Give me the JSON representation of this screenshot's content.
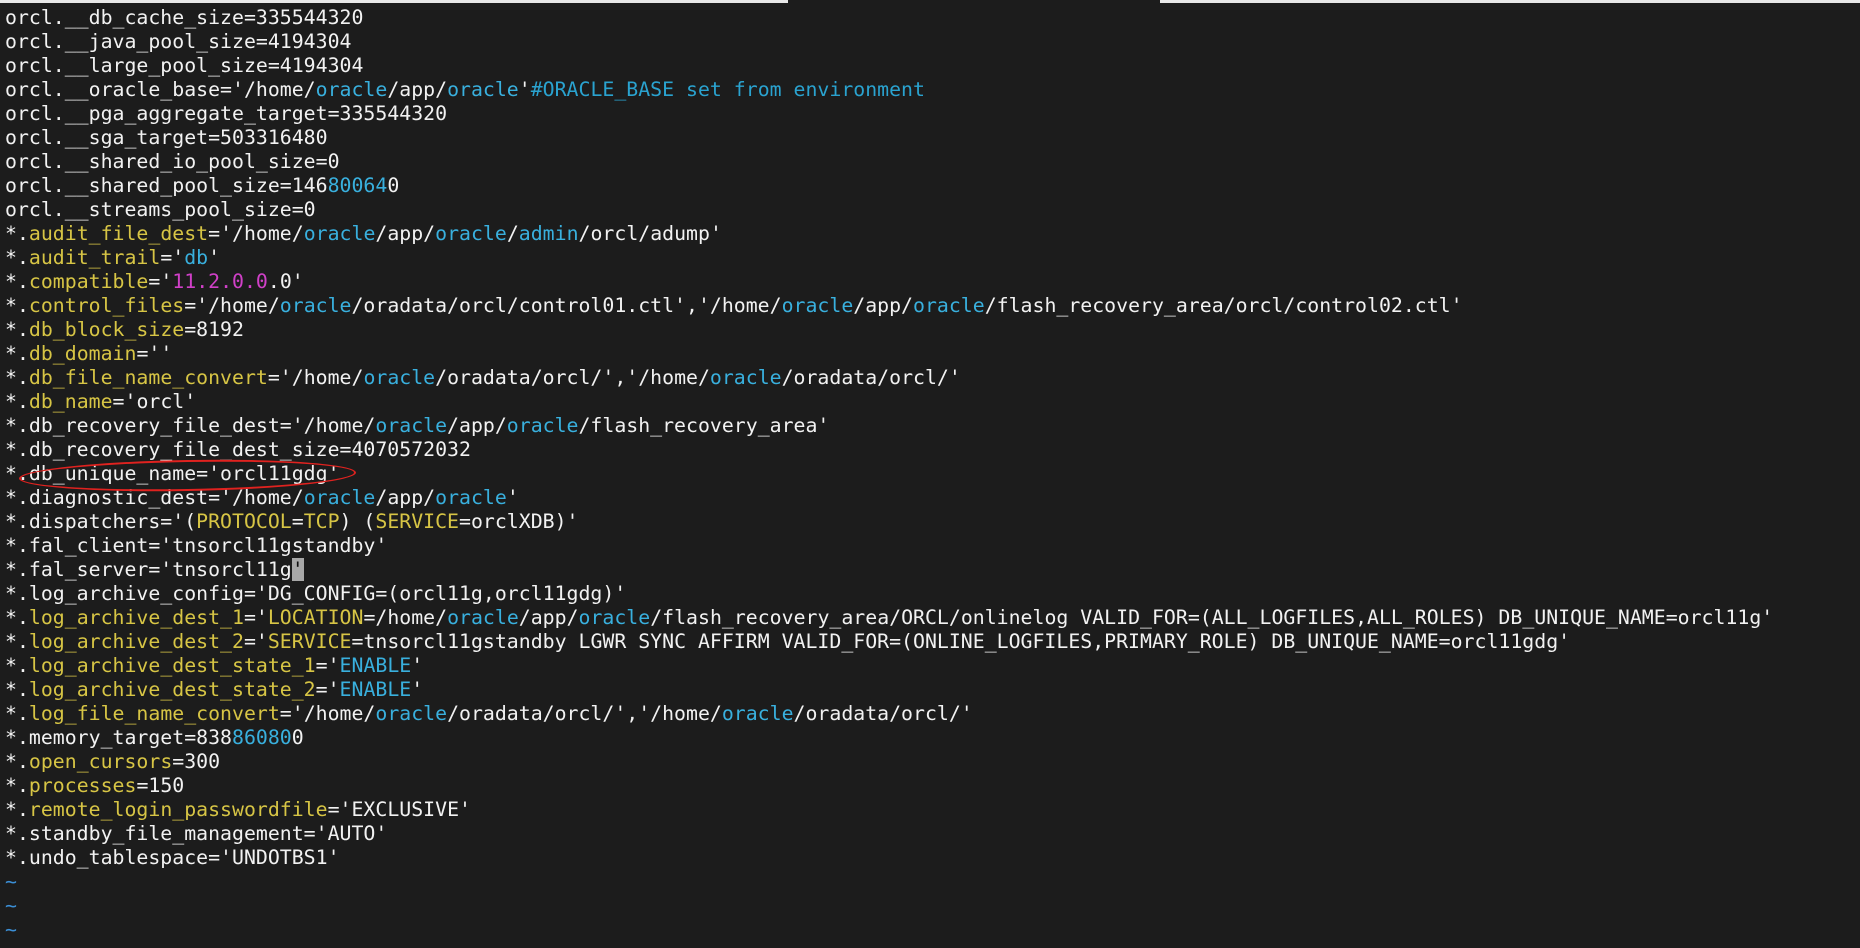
{
  "colors": {
    "background": "#1c1c1c",
    "text": "#f2f2f2",
    "parameter": "#d7c545",
    "keyword": "#39b0de",
    "comment": "#2aa3d0",
    "number": "#d040c8",
    "tilde": "#3b8fd6",
    "annotation": "#e0221f"
  },
  "editor": {
    "lines": [
      [
        {
          "t": "orcl.__db_cache_size=335544320",
          "s": "plain"
        }
      ],
      [
        {
          "t": "orcl.__java_pool_size=4194304",
          "s": "plain"
        }
      ],
      [
        {
          "t": "orcl.__large_pool_size=4194304",
          "s": "plain"
        }
      ],
      [
        {
          "t": "orcl.__oracle_base='/home/",
          "s": "plain"
        },
        {
          "t": "oracle",
          "s": "kw"
        },
        {
          "t": "/app/",
          "s": "plain"
        },
        {
          "t": "oracle",
          "s": "kw"
        },
        {
          "t": "'",
          "s": "plain"
        },
        {
          "t": "#ORACLE_BASE set from environment",
          "s": "comment"
        }
      ],
      [
        {
          "t": "orcl.__pga_aggregate_target=335544320",
          "s": "plain"
        }
      ],
      [
        {
          "t": "orcl.__sga_target=503316480",
          "s": "plain"
        }
      ],
      [
        {
          "t": "orcl.__shared_io_pool_size=0",
          "s": "plain"
        }
      ],
      [
        {
          "t": "orcl.__shared_pool_size=146",
          "s": "plain"
        },
        {
          "t": "80064",
          "s": "kw"
        },
        {
          "t": "0",
          "s": "plain"
        }
      ],
      [
        {
          "t": "orcl.__streams_pool_size=0",
          "s": "plain"
        }
      ],
      [
        {
          "t": "*.",
          "s": "plain"
        },
        {
          "t": "audit_file_dest",
          "s": "param"
        },
        {
          "t": "='/home/",
          "s": "plain"
        },
        {
          "t": "oracle",
          "s": "kw"
        },
        {
          "t": "/app/",
          "s": "plain"
        },
        {
          "t": "oracle",
          "s": "kw"
        },
        {
          "t": "/",
          "s": "plain"
        },
        {
          "t": "admin",
          "s": "kw"
        },
        {
          "t": "/orcl/adump'",
          "s": "plain"
        }
      ],
      [
        {
          "t": "*.",
          "s": "plain"
        },
        {
          "t": "audit_trail",
          "s": "param"
        },
        {
          "t": "='",
          "s": "plain"
        },
        {
          "t": "db",
          "s": "kw"
        },
        {
          "t": "'",
          "s": "plain"
        }
      ],
      [
        {
          "t": "*.",
          "s": "plain"
        },
        {
          "t": "compatible",
          "s": "param"
        },
        {
          "t": "='",
          "s": "plain"
        },
        {
          "t": "11.2.0.0",
          "s": "num"
        },
        {
          "t": ".0'",
          "s": "plain"
        }
      ],
      [
        {
          "t": "*.",
          "s": "plain"
        },
        {
          "t": "control_files",
          "s": "param"
        },
        {
          "t": "='/home/",
          "s": "plain"
        },
        {
          "t": "oracle",
          "s": "kw"
        },
        {
          "t": "/oradata/orcl/control01.ctl','/home/",
          "s": "plain"
        },
        {
          "t": "oracle",
          "s": "kw"
        },
        {
          "t": "/app/",
          "s": "plain"
        },
        {
          "t": "oracle",
          "s": "kw"
        },
        {
          "t": "/flash_recovery_area/orcl/control02.ctl'",
          "s": "plain"
        }
      ],
      [
        {
          "t": "*.",
          "s": "plain"
        },
        {
          "t": "db_block_size",
          "s": "param"
        },
        {
          "t": "=8192",
          "s": "plain"
        }
      ],
      [
        {
          "t": "*.",
          "s": "plain"
        },
        {
          "t": "db_domain",
          "s": "param"
        },
        {
          "t": "=''",
          "s": "plain"
        }
      ],
      [
        {
          "t": "*.",
          "s": "plain"
        },
        {
          "t": "db_file_name_convert",
          "s": "param"
        },
        {
          "t": "='/home/",
          "s": "plain"
        },
        {
          "t": "oracle",
          "s": "kw"
        },
        {
          "t": "/oradata/orcl/','/home/",
          "s": "plain"
        },
        {
          "t": "oracle",
          "s": "kw"
        },
        {
          "t": "/oradata/orcl/'",
          "s": "plain"
        }
      ],
      [
        {
          "t": "*.",
          "s": "plain"
        },
        {
          "t": "db_name",
          "s": "param"
        },
        {
          "t": "='orcl'",
          "s": "plain"
        }
      ],
      [
        {
          "t": "*.db_recovery_file_dest='/home/",
          "s": "plain"
        },
        {
          "t": "oracle",
          "s": "kw"
        },
        {
          "t": "/app/",
          "s": "plain"
        },
        {
          "t": "oracle",
          "s": "kw"
        },
        {
          "t": "/flash_recovery_area'",
          "s": "plain"
        }
      ],
      [
        {
          "t": "*.db_recovery_file_dest_size=4070572032",
          "s": "plain"
        }
      ],
      [
        {
          "t": "*.db_unique_name='orcl11gdg'",
          "s": "plain"
        }
      ],
      [
        {
          "t": "*.diagnostic_dest='/home/",
          "s": "plain"
        },
        {
          "t": "oracle",
          "s": "kw"
        },
        {
          "t": "/app/",
          "s": "plain"
        },
        {
          "t": "oracle",
          "s": "kw"
        },
        {
          "t": "'",
          "s": "plain"
        }
      ],
      [
        {
          "t": "*.dispatchers='(",
          "s": "plain"
        },
        {
          "t": "PROTOCOL",
          "s": "param"
        },
        {
          "t": "=",
          "s": "plain"
        },
        {
          "t": "TCP",
          "s": "param"
        },
        {
          "t": ") (",
          "s": "plain"
        },
        {
          "t": "SERVICE",
          "s": "param"
        },
        {
          "t": "=orclXDB)'",
          "s": "plain"
        }
      ],
      [
        {
          "t": "*.fal_client='tnsorcl11gstandby'",
          "s": "plain"
        }
      ],
      [
        {
          "t": "*.fal_server='tnsorcl11g",
          "s": "plain"
        },
        {
          "t": "'",
          "s": "cursor"
        }
      ],
      [
        {
          "t": "*.log_archive_config='DG_CONFIG=(orcl11g,orcl11gdg)'",
          "s": "plain"
        }
      ],
      [
        {
          "t": "*.",
          "s": "plain"
        },
        {
          "t": "log_archive_dest_1",
          "s": "param"
        },
        {
          "t": "='",
          "s": "plain"
        },
        {
          "t": "LOCATION",
          "s": "param"
        },
        {
          "t": "=/home/",
          "s": "plain"
        },
        {
          "t": "oracle",
          "s": "kw"
        },
        {
          "t": "/app/",
          "s": "plain"
        },
        {
          "t": "oracle",
          "s": "kw"
        },
        {
          "t": "/flash_recovery_area/ORCL/onlinelog VALID_FOR=(ALL_LOGFILES,ALL_ROLES) DB_UNIQUE_NAME=orcl11g'",
          "s": "plain"
        }
      ],
      [
        {
          "t": "*.",
          "s": "plain"
        },
        {
          "t": "log_archive_dest_2",
          "s": "param"
        },
        {
          "t": "='",
          "s": "plain"
        },
        {
          "t": "SERVICE",
          "s": "param"
        },
        {
          "t": "=tnsorcl11gstandby LGWR SYNC AFFIRM VALID_FOR=(ONLINE_LOGFILES,PRIMARY_ROLE) DB_UNIQUE_NAME=orcl11gdg'",
          "s": "plain"
        }
      ],
      [
        {
          "t": "*.",
          "s": "plain"
        },
        {
          "t": "log_archive_dest_state_1",
          "s": "param"
        },
        {
          "t": "='",
          "s": "plain"
        },
        {
          "t": "ENABLE",
          "s": "kw"
        },
        {
          "t": "'",
          "s": "plain"
        }
      ],
      [
        {
          "t": "*.",
          "s": "plain"
        },
        {
          "t": "log_archive_dest_state_2",
          "s": "param"
        },
        {
          "t": "='",
          "s": "plain"
        },
        {
          "t": "ENABLE",
          "s": "kw"
        },
        {
          "t": "'",
          "s": "plain"
        }
      ],
      [
        {
          "t": "*.",
          "s": "plain"
        },
        {
          "t": "log_file_name_convert",
          "s": "param"
        },
        {
          "t": "='/home/",
          "s": "plain"
        },
        {
          "t": "oracle",
          "s": "kw"
        },
        {
          "t": "/oradata/orcl/','/home/",
          "s": "plain"
        },
        {
          "t": "oracle",
          "s": "kw"
        },
        {
          "t": "/oradata/orcl/'",
          "s": "plain"
        }
      ],
      [
        {
          "t": "*.memory_target=838",
          "s": "plain"
        },
        {
          "t": "86080",
          "s": "kw"
        },
        {
          "t": "0",
          "s": "plain"
        }
      ],
      [
        {
          "t": "*.",
          "s": "plain"
        },
        {
          "t": "open_cursors",
          "s": "param"
        },
        {
          "t": "=300",
          "s": "plain"
        }
      ],
      [
        {
          "t": "*.",
          "s": "plain"
        },
        {
          "t": "processes",
          "s": "param"
        },
        {
          "t": "=150",
          "s": "plain"
        }
      ],
      [
        {
          "t": "*.",
          "s": "plain"
        },
        {
          "t": "remote_login_passwordfile",
          "s": "param"
        },
        {
          "t": "='EXCLUSIVE'",
          "s": "plain"
        }
      ],
      [
        {
          "t": "*.standby_file_management='AUTO'",
          "s": "plain"
        }
      ],
      [
        {
          "t": "*.undo_tablespace='UNDOTBS1'",
          "s": "plain"
        }
      ]
    ],
    "empty_line_markers": [
      "~",
      "~",
      "~"
    ],
    "annotation": {
      "shape": "red ellipse",
      "highlights": "*.db_unique_name='orcl11gdg'"
    }
  }
}
